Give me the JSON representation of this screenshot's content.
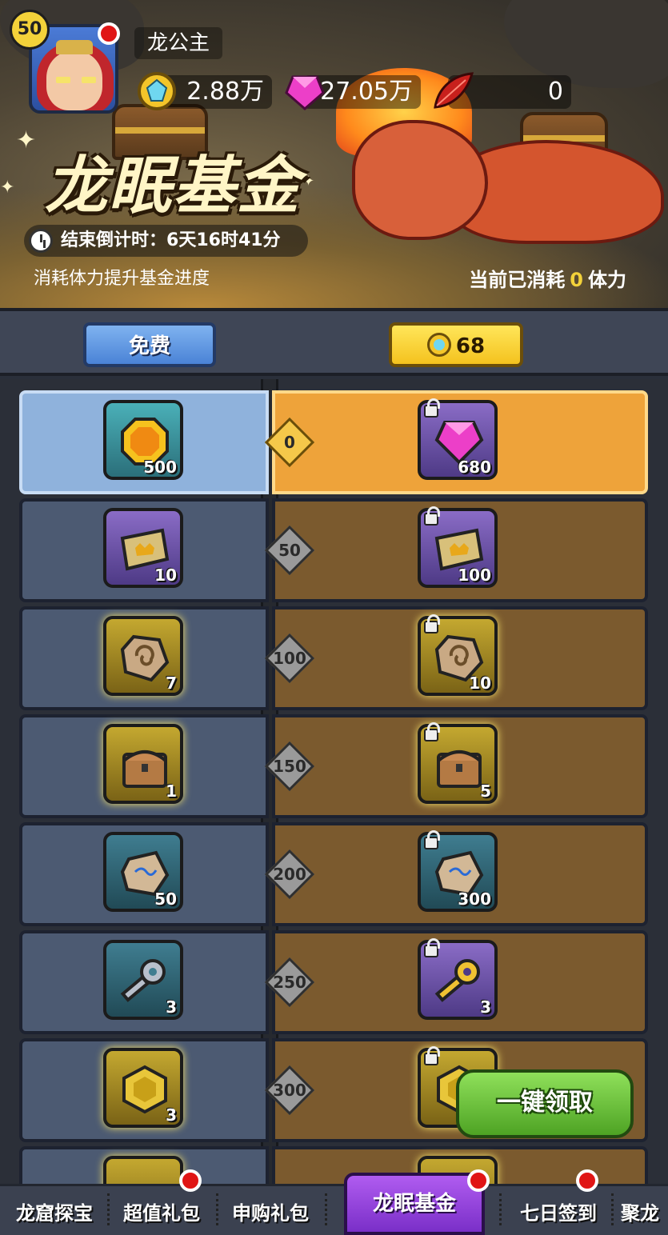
{
  "player": {
    "level": "50",
    "name": "龙公主"
  },
  "resources": [
    {
      "icon": "gem-coin-icon",
      "value": "2.88万"
    },
    {
      "icon": "pink-diamond-icon",
      "value": "27.05万"
    },
    {
      "icon": "red-feather-icon",
      "value": "0"
    }
  ],
  "banner": {
    "title": "龙眠基金",
    "countdown_label": "结束倒计时：",
    "countdown_value": "6天16时41分",
    "subtitle": "消耗体力提升基金进度",
    "consumed_prefix": "当前已消耗",
    "consumed_value": "0",
    "consumed_suffix": "体力"
  },
  "tiers": {
    "free_label": "免费",
    "paid_price": "68"
  },
  "rows": [
    {
      "milestone": "0",
      "free": {
        "icon": "gold-coin-icon",
        "qty": "500",
        "quality": "teal"
      },
      "paid": {
        "icon": "pink-gem-icon",
        "qty": "680",
        "quality": "purple",
        "locked": true
      },
      "active": true
    },
    {
      "milestone": "50",
      "free": {
        "icon": "ticket-icon",
        "qty": "10",
        "quality": "purple"
      },
      "paid": {
        "icon": "ticket-icon",
        "qty": "100",
        "quality": "purple",
        "locked": true
      }
    },
    {
      "milestone": "100",
      "free": {
        "icon": "rune-stone-icon",
        "qty": "7",
        "quality": "gold"
      },
      "paid": {
        "icon": "rune-stone-icon",
        "qty": "10",
        "quality": "gold",
        "locked": true
      }
    },
    {
      "milestone": "150",
      "free": {
        "icon": "treasure-chest-icon",
        "qty": "1",
        "quality": "gold"
      },
      "paid": {
        "icon": "treasure-chest-icon",
        "qty": "5",
        "quality": "gold",
        "locked": true
      }
    },
    {
      "milestone": "200",
      "free": {
        "icon": "ore-stone-icon",
        "qty": "50",
        "quality": "blue"
      },
      "paid": {
        "icon": "ore-stone-icon",
        "qty": "300",
        "quality": "blue",
        "locked": true
      }
    },
    {
      "milestone": "250",
      "free": {
        "icon": "silver-key-icon",
        "qty": "3",
        "quality": "blue"
      },
      "paid": {
        "icon": "gold-key-icon",
        "qty": "3",
        "quality": "purple",
        "locked": true
      }
    },
    {
      "milestone": "300",
      "free": {
        "icon": "gold-hexagon-icon",
        "qty": "3",
        "quality": "gold"
      },
      "paid": {
        "icon": "gold-hexagon-icon",
        "qty": "",
        "quality": "gold",
        "locked": true
      }
    }
  ],
  "claim_button": "一键领取",
  "nav": [
    {
      "label": "龙窟探宝",
      "dot": false
    },
    {
      "label": "超值礼包",
      "dot": true
    },
    {
      "label": "申购礼包",
      "dot": false
    },
    {
      "label": "龙眠基金",
      "dot": true,
      "active": true
    },
    {
      "label": "七日签到",
      "dot": true
    },
    {
      "label": "聚龙",
      "dot": false
    }
  ],
  "colors": {
    "free_cell": "#4c5a72",
    "paid_cell": "#7b5a2e",
    "active_free": "#8fb2dc",
    "active_paid": "#eea33a",
    "claim": "#4ea324",
    "nav_active": "#7a2fc8"
  }
}
